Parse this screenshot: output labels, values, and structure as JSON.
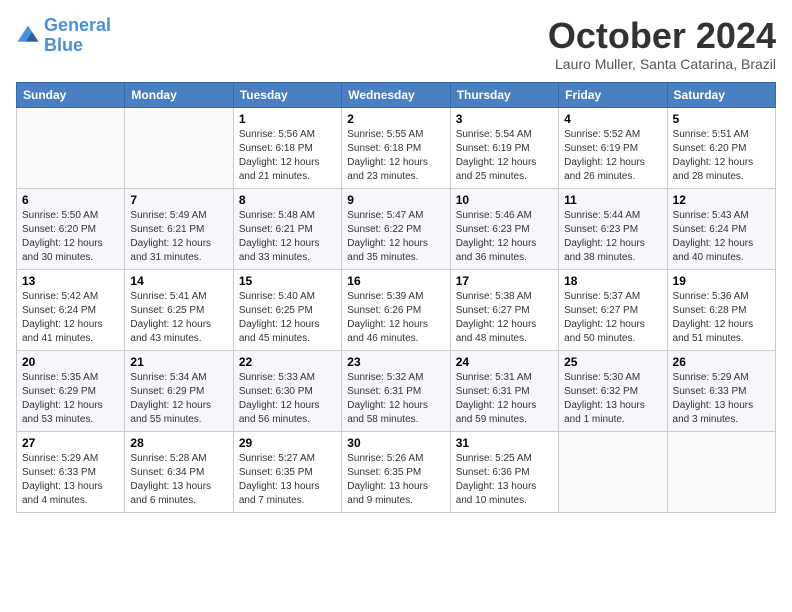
{
  "logo": {
    "line1": "General",
    "line2": "Blue"
  },
  "title": "October 2024",
  "subtitle": "Lauro Muller, Santa Catarina, Brazil",
  "days_header": [
    "Sunday",
    "Monday",
    "Tuesday",
    "Wednesday",
    "Thursday",
    "Friday",
    "Saturday"
  ],
  "weeks": [
    [
      {
        "num": "",
        "info": ""
      },
      {
        "num": "",
        "info": ""
      },
      {
        "num": "1",
        "info": "Sunrise: 5:56 AM\nSunset: 6:18 PM\nDaylight: 12 hours and 21 minutes."
      },
      {
        "num": "2",
        "info": "Sunrise: 5:55 AM\nSunset: 6:18 PM\nDaylight: 12 hours and 23 minutes."
      },
      {
        "num": "3",
        "info": "Sunrise: 5:54 AM\nSunset: 6:19 PM\nDaylight: 12 hours and 25 minutes."
      },
      {
        "num": "4",
        "info": "Sunrise: 5:52 AM\nSunset: 6:19 PM\nDaylight: 12 hours and 26 minutes."
      },
      {
        "num": "5",
        "info": "Sunrise: 5:51 AM\nSunset: 6:20 PM\nDaylight: 12 hours and 28 minutes."
      }
    ],
    [
      {
        "num": "6",
        "info": "Sunrise: 5:50 AM\nSunset: 6:20 PM\nDaylight: 12 hours and 30 minutes."
      },
      {
        "num": "7",
        "info": "Sunrise: 5:49 AM\nSunset: 6:21 PM\nDaylight: 12 hours and 31 minutes."
      },
      {
        "num": "8",
        "info": "Sunrise: 5:48 AM\nSunset: 6:21 PM\nDaylight: 12 hours and 33 minutes."
      },
      {
        "num": "9",
        "info": "Sunrise: 5:47 AM\nSunset: 6:22 PM\nDaylight: 12 hours and 35 minutes."
      },
      {
        "num": "10",
        "info": "Sunrise: 5:46 AM\nSunset: 6:23 PM\nDaylight: 12 hours and 36 minutes."
      },
      {
        "num": "11",
        "info": "Sunrise: 5:44 AM\nSunset: 6:23 PM\nDaylight: 12 hours and 38 minutes."
      },
      {
        "num": "12",
        "info": "Sunrise: 5:43 AM\nSunset: 6:24 PM\nDaylight: 12 hours and 40 minutes."
      }
    ],
    [
      {
        "num": "13",
        "info": "Sunrise: 5:42 AM\nSunset: 6:24 PM\nDaylight: 12 hours and 41 minutes."
      },
      {
        "num": "14",
        "info": "Sunrise: 5:41 AM\nSunset: 6:25 PM\nDaylight: 12 hours and 43 minutes."
      },
      {
        "num": "15",
        "info": "Sunrise: 5:40 AM\nSunset: 6:25 PM\nDaylight: 12 hours and 45 minutes."
      },
      {
        "num": "16",
        "info": "Sunrise: 5:39 AM\nSunset: 6:26 PM\nDaylight: 12 hours and 46 minutes."
      },
      {
        "num": "17",
        "info": "Sunrise: 5:38 AM\nSunset: 6:27 PM\nDaylight: 12 hours and 48 minutes."
      },
      {
        "num": "18",
        "info": "Sunrise: 5:37 AM\nSunset: 6:27 PM\nDaylight: 12 hours and 50 minutes."
      },
      {
        "num": "19",
        "info": "Sunrise: 5:36 AM\nSunset: 6:28 PM\nDaylight: 12 hours and 51 minutes."
      }
    ],
    [
      {
        "num": "20",
        "info": "Sunrise: 5:35 AM\nSunset: 6:29 PM\nDaylight: 12 hours and 53 minutes."
      },
      {
        "num": "21",
        "info": "Sunrise: 5:34 AM\nSunset: 6:29 PM\nDaylight: 12 hours and 55 minutes."
      },
      {
        "num": "22",
        "info": "Sunrise: 5:33 AM\nSunset: 6:30 PM\nDaylight: 12 hours and 56 minutes."
      },
      {
        "num": "23",
        "info": "Sunrise: 5:32 AM\nSunset: 6:31 PM\nDaylight: 12 hours and 58 minutes."
      },
      {
        "num": "24",
        "info": "Sunrise: 5:31 AM\nSunset: 6:31 PM\nDaylight: 12 hours and 59 minutes."
      },
      {
        "num": "25",
        "info": "Sunrise: 5:30 AM\nSunset: 6:32 PM\nDaylight: 13 hours and 1 minute."
      },
      {
        "num": "26",
        "info": "Sunrise: 5:29 AM\nSunset: 6:33 PM\nDaylight: 13 hours and 3 minutes."
      }
    ],
    [
      {
        "num": "27",
        "info": "Sunrise: 5:29 AM\nSunset: 6:33 PM\nDaylight: 13 hours and 4 minutes."
      },
      {
        "num": "28",
        "info": "Sunrise: 5:28 AM\nSunset: 6:34 PM\nDaylight: 13 hours and 6 minutes."
      },
      {
        "num": "29",
        "info": "Sunrise: 5:27 AM\nSunset: 6:35 PM\nDaylight: 13 hours and 7 minutes."
      },
      {
        "num": "30",
        "info": "Sunrise: 5:26 AM\nSunset: 6:35 PM\nDaylight: 13 hours and 9 minutes."
      },
      {
        "num": "31",
        "info": "Sunrise: 5:25 AM\nSunset: 6:36 PM\nDaylight: 13 hours and 10 minutes."
      },
      {
        "num": "",
        "info": ""
      },
      {
        "num": "",
        "info": ""
      }
    ]
  ]
}
